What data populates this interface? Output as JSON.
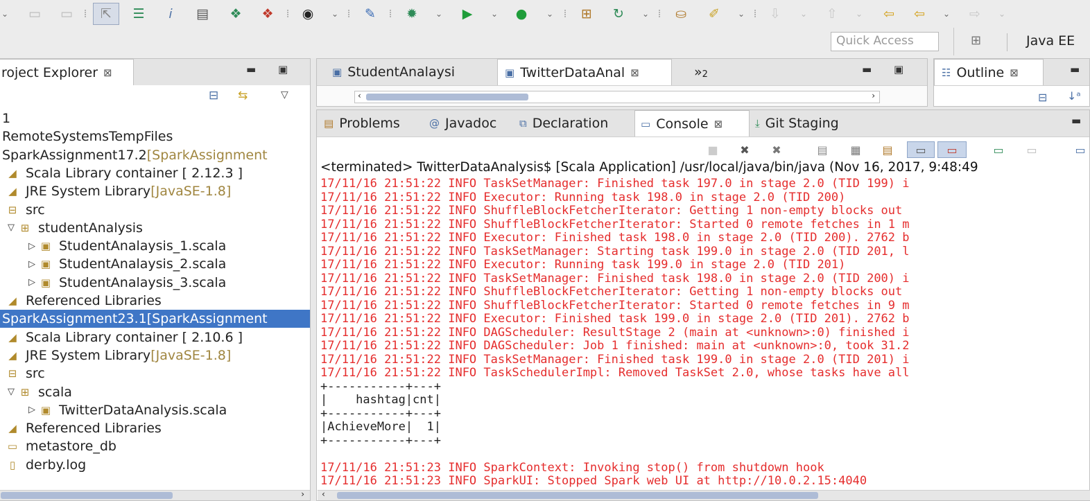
{
  "toolbar": {
    "icons": [
      "new-icon",
      "save-icon",
      "save-all-icon",
      "step-filter-icon",
      "task-list-icon",
      "javadoc-icon",
      "properties-icon",
      "new-class-icon",
      "new-ejb-icon",
      "profile-icon",
      "pin-icon",
      "debug-icon",
      "run-icon",
      "run-external-icon",
      "package-icon",
      "refresh-icon",
      "open-type-icon",
      "search-icon",
      "nav-down-icon",
      "nav-up-icon",
      "prev-edit-icon",
      "back-icon",
      "forward-icon"
    ]
  },
  "quick_access": {
    "placeholder": "Quick Access"
  },
  "perspective": {
    "label": "Java EE"
  },
  "explorer": {
    "tab_label": "roject Explorer",
    "items": [
      {
        "label": "1",
        "decoration": "",
        "icon": "folder-icon",
        "twisty": ""
      },
      {
        "label": "RemoteSystemsTempFiles",
        "decoration": "",
        "icon": "project-icon",
        "twisty": ""
      },
      {
        "label": "SparkAssignment17.2 ",
        "decoration": "[SparkAssignment",
        "icon": "project-icon",
        "twisty": ""
      },
      {
        "label": "Scala Library container [ 2.12.3 ]",
        "decoration": "",
        "icon": "library-icon",
        "twisty": ""
      },
      {
        "label": "JRE System Library ",
        "decoration": "[JavaSE-1.8]",
        "icon": "library-icon",
        "twisty": ""
      },
      {
        "label": "src",
        "decoration": "",
        "icon": "source-folder-icon",
        "twisty": ""
      },
      {
        "label": "studentAnalysis",
        "decoration": "",
        "icon": "package-icon",
        "twisty": "▽"
      },
      {
        "label": "StudentAnalaysis_1.scala",
        "decoration": "",
        "icon": "scala-file-icon",
        "twisty": "▷"
      },
      {
        "label": "StudentAnalaysis_2.scala",
        "decoration": "",
        "icon": "scala-file-icon",
        "twisty": "▷"
      },
      {
        "label": "StudentAnalaysis_3.scala",
        "decoration": "",
        "icon": "scala-file-icon",
        "twisty": "▷"
      },
      {
        "label": "Referenced Libraries",
        "decoration": "",
        "icon": "library-icon",
        "twisty": ""
      },
      {
        "label": "SparkAssignment23.1 ",
        "decoration": "[SparkAssignment",
        "icon": "project-icon",
        "twisty": ""
      },
      {
        "label": "Scala Library container [ 2.10.6 ]",
        "decoration": "",
        "icon": "library-icon",
        "twisty": ""
      },
      {
        "label": "JRE System Library ",
        "decoration": "[JavaSE-1.8]",
        "icon": "library-icon",
        "twisty": ""
      },
      {
        "label": "src",
        "decoration": "",
        "icon": "source-folder-icon",
        "twisty": ""
      },
      {
        "label": "scala",
        "decoration": "",
        "icon": "package-icon",
        "twisty": "▽"
      },
      {
        "label": "TwitterDataAnalysis.scala",
        "decoration": "",
        "icon": "scala-file-icon",
        "twisty": "▷"
      },
      {
        "label": "Referenced Libraries",
        "decoration": "",
        "icon": "library-icon",
        "twisty": ""
      },
      {
        "label": "metastore_db",
        "decoration": "",
        "icon": "folder-icon",
        "twisty": ""
      },
      {
        "label": "derby.log",
        "decoration": "",
        "icon": "file-icon",
        "twisty": ""
      }
    ]
  },
  "editor": {
    "tabs": [
      {
        "label": "StudentAnalaysi",
        "active": false
      },
      {
        "label": "TwitterDataAnal",
        "active": true
      }
    ],
    "overflow_label": "»",
    "overflow_count": "2"
  },
  "outline": {
    "tab_label": "Outline"
  },
  "bottom": {
    "tabs": [
      {
        "label": "Problems",
        "icon": "problems-icon"
      },
      {
        "label": "Javadoc",
        "icon": "javadoc-icon"
      },
      {
        "label": "Declaration",
        "icon": "declaration-icon"
      },
      {
        "label": "Console",
        "icon": "console-icon"
      },
      {
        "label": "Git Staging",
        "icon": "git-staging-icon"
      }
    ],
    "active_tab": "Console"
  },
  "console": {
    "header": "<terminated> TwitterDataAnalysis$ [Scala Application] /usr/local/java/bin/java (Nov 16, 2017, 9:48:49",
    "lines": [
      {
        "text": "17/11/16 21:51:22 INFO TaskSetManager: Finished task 197.0 in stage 2.0 (TID 199) i",
        "kind": "log"
      },
      {
        "text": "17/11/16 21:51:22 INFO Executor: Running task 198.0 in stage 2.0 (TID 200)",
        "kind": "log"
      },
      {
        "text": "17/11/16 21:51:22 INFO ShuffleBlockFetcherIterator: Getting 1 non-empty blocks out",
        "kind": "log"
      },
      {
        "text": "17/11/16 21:51:22 INFO ShuffleBlockFetcherIterator: Started 0 remote fetches in 1 m",
        "kind": "log"
      },
      {
        "text": "17/11/16 21:51:22 INFO Executor: Finished task 198.0 in stage 2.0 (TID 200). 2762 b",
        "kind": "log"
      },
      {
        "text": "17/11/16 21:51:22 INFO TaskSetManager: Starting task 199.0 in stage 2.0 (TID 201, l",
        "kind": "log"
      },
      {
        "text": "17/11/16 21:51:22 INFO Executor: Running task 199.0 in stage 2.0 (TID 201)",
        "kind": "log"
      },
      {
        "text": "17/11/16 21:51:22 INFO TaskSetManager: Finished task 198.0 in stage 2.0 (TID 200) i",
        "kind": "log"
      },
      {
        "text": "17/11/16 21:51:22 INFO ShuffleBlockFetcherIterator: Getting 1 non-empty blocks out",
        "kind": "log"
      },
      {
        "text": "17/11/16 21:51:22 INFO ShuffleBlockFetcherIterator: Started 0 remote fetches in 9 m",
        "kind": "log"
      },
      {
        "text": "17/11/16 21:51:22 INFO Executor: Finished task 199.0 in stage 2.0 (TID 201). 2762 b",
        "kind": "log"
      },
      {
        "text": "17/11/16 21:51:22 INFO DAGScheduler: ResultStage 2 (main at <unknown>:0) finished i",
        "kind": "log"
      },
      {
        "text": "17/11/16 21:51:22 INFO DAGScheduler: Job 1 finished: main at <unknown>:0, took 31.2",
        "kind": "log"
      },
      {
        "text": "17/11/16 21:51:22 INFO TaskSetManager: Finished task 199.0 in stage 2.0 (TID 201) i",
        "kind": "log"
      },
      {
        "text": "17/11/16 21:51:22 INFO TaskSchedulerImpl: Removed TaskSet 2.0, whose tasks have all",
        "kind": "log"
      },
      {
        "text": "+-----------+---+",
        "kind": "out"
      },
      {
        "text": "|    hashtag|cnt|",
        "kind": "out"
      },
      {
        "text": "+-----------+---+",
        "kind": "out"
      },
      {
        "text": "|AchieveMore|  1|",
        "kind": "out"
      },
      {
        "text": "+-----------+---+",
        "kind": "out"
      },
      {
        "text": "",
        "kind": "out"
      },
      {
        "text": "17/11/16 21:51:23 INFO SparkContext: Invoking stop() from shutdown hook",
        "kind": "log"
      },
      {
        "text": "17/11/16 21:51:23 INFO SparkUI: Stopped Spark web UI at http://10.0.2.15:4040",
        "kind": "log"
      }
    ],
    "toolbar_icons": [
      "terminate-icon",
      "remove-launch-icon",
      "remove-all-icon",
      "scroll-lock-icon",
      "word-wrap-icon",
      "clear-console-icon",
      "show-stdout-icon",
      "show-stderr-icon",
      "pin-console-icon",
      "new-console-icon",
      "open-console-icon"
    ]
  },
  "colors": {
    "log": "#e52d2d",
    "selection": "#3f76c6",
    "decoration": "#a08640"
  }
}
